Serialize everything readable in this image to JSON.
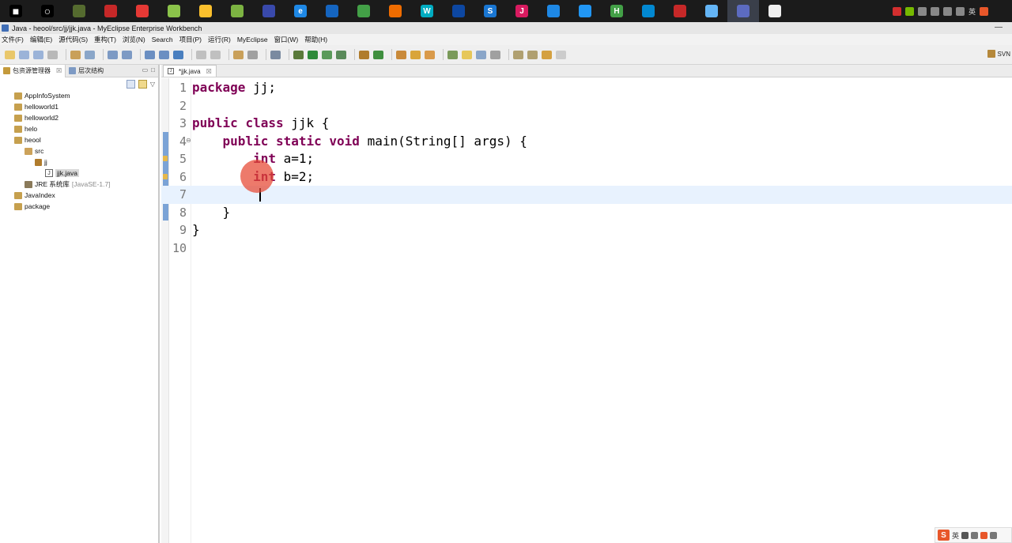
{
  "taskbar": {
    "apps": [
      {
        "icon": "windows-start-icon",
        "color": "#000000",
        "glyph": "■"
      },
      {
        "icon": "search-circle-icon",
        "color": "#000000",
        "glyph": "○"
      },
      {
        "icon": "speedometer-icon",
        "color": "#556b2f",
        "glyph": ""
      },
      {
        "icon": "red-app-icon",
        "color": "#c62828",
        "glyph": ""
      },
      {
        "icon": "netease-music-icon",
        "color": "#e53935",
        "glyph": ""
      },
      {
        "icon": "green-ball-icon",
        "color": "#8bc34a",
        "glyph": ""
      },
      {
        "icon": "chrome-icon",
        "color": "#fbc02d",
        "glyph": ""
      },
      {
        "icon": "notepad-icon",
        "color": "#7cb342",
        "glyph": ""
      },
      {
        "icon": "myeclipse-blue-icon",
        "color": "#3949ab",
        "glyph": ""
      },
      {
        "icon": "edge-icon",
        "color": "#1e88e5",
        "glyph": "e"
      },
      {
        "icon": "blue-editor-icon",
        "color": "#1565c0",
        "glyph": ""
      },
      {
        "icon": "wechat-icon",
        "color": "#43a047",
        "glyph": ""
      },
      {
        "icon": "firefox-icon",
        "color": "#ef6c00",
        "glyph": ""
      },
      {
        "icon": "webstorm-icon",
        "color": "#00acc1",
        "glyph": "W"
      },
      {
        "icon": "dark-blue-icon",
        "color": "#0d47a1",
        "glyph": ""
      },
      {
        "icon": "blue-circle-s-icon",
        "color": "#1976d2",
        "glyph": "S"
      },
      {
        "icon": "intellij-icon",
        "color": "#d81b60",
        "glyph": "J"
      },
      {
        "icon": "blue-gear-icon",
        "color": "#1e88e5",
        "glyph": ""
      },
      {
        "icon": "vscode-icon",
        "color": "#2196f3",
        "glyph": ""
      },
      {
        "icon": "hbuilder-icon",
        "color": "#43a047",
        "glyph": "H"
      },
      {
        "icon": "cloud-icon",
        "color": "#0288d1",
        "glyph": ""
      },
      {
        "icon": "red-white-icon",
        "color": "#c62828",
        "glyph": ""
      },
      {
        "icon": "blue-book-icon",
        "color": "#64b5f6",
        "glyph": ""
      },
      {
        "icon": "myeclipse-active-icon",
        "color": "#5c6bc0",
        "glyph": ""
      },
      {
        "icon": "file-white-icon",
        "color": "#eeeeee",
        "glyph": ""
      }
    ],
    "tray_text": "英"
  },
  "window": {
    "title": "Java - heool/src/jj/jjk.java - MyEclipse Enterprise Workbench",
    "minimize": "—"
  },
  "menu": [
    "文件(F)",
    "编辑(E)",
    "源代码(S)",
    "重构(T)",
    "浏览(N)",
    "Search",
    "项目(P)",
    "运行(R)",
    "MyEclipse",
    "窗口(W)",
    "帮助(H)"
  ],
  "toolbar": {
    "perspective_label": "SVN"
  },
  "package_explorer": {
    "tab_label": "包资源管理器",
    "tab_close": "☒",
    "hierarchy_tab_label": "层次结构",
    "ctrl_min": "▭",
    "ctrl_max": "□",
    "tree": [
      {
        "label": "AppInfoSystem",
        "kind": "project",
        "level": 0
      },
      {
        "label": "helloworld1",
        "kind": "project",
        "level": 0
      },
      {
        "label": "helloworld2",
        "kind": "project",
        "level": 0
      },
      {
        "label": "helo",
        "kind": "project",
        "level": 0
      },
      {
        "label": "heool",
        "kind": "project",
        "level": 0
      },
      {
        "label": "src",
        "kind": "src",
        "level": 1
      },
      {
        "label": "jj",
        "kind": "package",
        "level": 2
      },
      {
        "label": "jjk.java",
        "kind": "java",
        "level": 3,
        "selected": true
      },
      {
        "label": "JRE 系统库",
        "kind": "jre",
        "level": 1,
        "extra": "[JavaSE-1.7]"
      },
      {
        "label": "JavaIndex",
        "kind": "project",
        "level": 0
      },
      {
        "label": "package",
        "kind": "project",
        "level": 0
      }
    ]
  },
  "editor": {
    "tab_label": "*jjk.java",
    "tab_close": "☒",
    "lines": [
      {
        "num": "1",
        "tokens": [
          {
            "t": "package",
            "kw": true
          },
          {
            "t": " jj;"
          }
        ]
      },
      {
        "num": "2",
        "tokens": []
      },
      {
        "num": "3",
        "tokens": [
          {
            "t": "public",
            "kw": true
          },
          {
            "t": " "
          },
          {
            "t": "class",
            "kw": true
          },
          {
            "t": " jjk {"
          }
        ]
      },
      {
        "num": "4",
        "tokens": [
          {
            "t": "    "
          },
          {
            "t": "public",
            "kw": true
          },
          {
            "t": " "
          },
          {
            "t": "static",
            "kw": true
          },
          {
            "t": " "
          },
          {
            "t": "void",
            "kw": true
          },
          {
            "t": " main(String[] args) {"
          }
        ]
      },
      {
        "num": "5",
        "tokens": [
          {
            "t": "        "
          },
          {
            "t": "int",
            "kw": true
          },
          {
            "t": " a=1;"
          }
        ]
      },
      {
        "num": "6",
        "tokens": [
          {
            "t": "        "
          },
          {
            "t": "int",
            "kw": true
          },
          {
            "t": " b=2;"
          }
        ]
      },
      {
        "num": "7",
        "tokens": [],
        "current": true
      },
      {
        "num": "8",
        "tokens": [
          {
            "t": "    }"
          }
        ]
      },
      {
        "num": "9",
        "tokens": [
          {
            "t": "}"
          }
        ]
      },
      {
        "num": "10",
        "tokens": []
      }
    ]
  },
  "ime": {
    "logo": "S",
    "label": "英"
  },
  "colors": {
    "keyword": "#7f0055",
    "current_line": "#e8f2fe",
    "fold_bar": "#7ba3d6",
    "click_highlight": "#e64632"
  }
}
